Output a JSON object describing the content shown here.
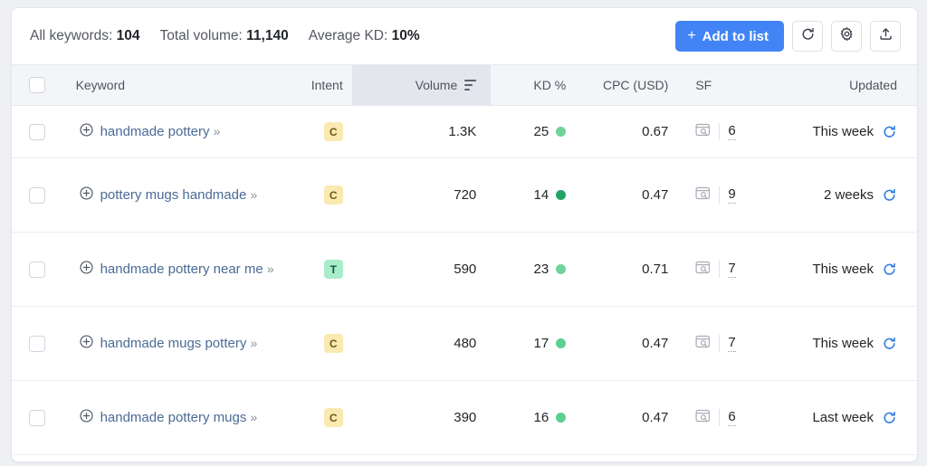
{
  "summary": {
    "all_keywords_label": "All keywords:",
    "all_keywords_value": "104",
    "total_volume_label": "Total volume:",
    "total_volume_value": "11,140",
    "average_kd_label": "Average KD:",
    "average_kd_value": "10%",
    "add_to_list_label": "Add to list",
    "plus_glyph": "+",
    "refresh_icon": "refresh-icon",
    "settings_icon": "gear-icon",
    "export_icon": "export-icon"
  },
  "table": {
    "columns": {
      "keyword": "Keyword",
      "intent": "Intent",
      "volume": "Volume",
      "kd": "KD %",
      "cpc": "CPC (USD)",
      "sf": "SF",
      "updated": "Updated"
    },
    "sorted_column": "Volume",
    "sort_direction": "descending",
    "rows": [
      {
        "keyword": "handmade pottery",
        "chevron": "»",
        "intent": "C",
        "intent_name": "Commercial",
        "volume": "1.3K",
        "kd": "25",
        "kd_color": "#6ed49a",
        "cpc": "0.67",
        "sf": "6",
        "updated": "This week",
        "wrapped": false
      },
      {
        "keyword": "pottery mugs handmade",
        "chevron": "»",
        "intent": "C",
        "intent_name": "Commercial",
        "volume": "720",
        "kd": "14",
        "kd_color": "#22a366",
        "cpc": "0.47",
        "sf": "9",
        "updated": "2 weeks",
        "wrapped": true
      },
      {
        "keyword": "handmade pottery near me",
        "chevron": "»",
        "intent": "T",
        "intent_name": "Transactional",
        "volume": "590",
        "kd": "23",
        "kd_color": "#6ed49a",
        "cpc": "0.71",
        "sf": "7",
        "updated": "This week",
        "wrapped": true
      },
      {
        "keyword": "handmade mugs pottery",
        "chevron": "»",
        "intent": "C",
        "intent_name": "Commercial",
        "volume": "480",
        "kd": "17",
        "kd_color": "#5ccf92",
        "cpc": "0.47",
        "sf": "7",
        "updated": "This week",
        "wrapped": true
      },
      {
        "keyword": "handmade pottery mugs",
        "chevron": "»",
        "intent": "C",
        "intent_name": "Commercial",
        "volume": "390",
        "kd": "16",
        "kd_color": "#5ccf92",
        "cpc": "0.47",
        "sf": "6",
        "updated": "Last week",
        "wrapped": true
      }
    ]
  },
  "colors": {
    "accent_blue": "#4284f5",
    "link_blue": "#4a6b96",
    "refresh_blue": "#2f7de1",
    "intent_commercial_bg": "#fae9b0",
    "intent_transactional_bg": "#a9ecc9"
  }
}
